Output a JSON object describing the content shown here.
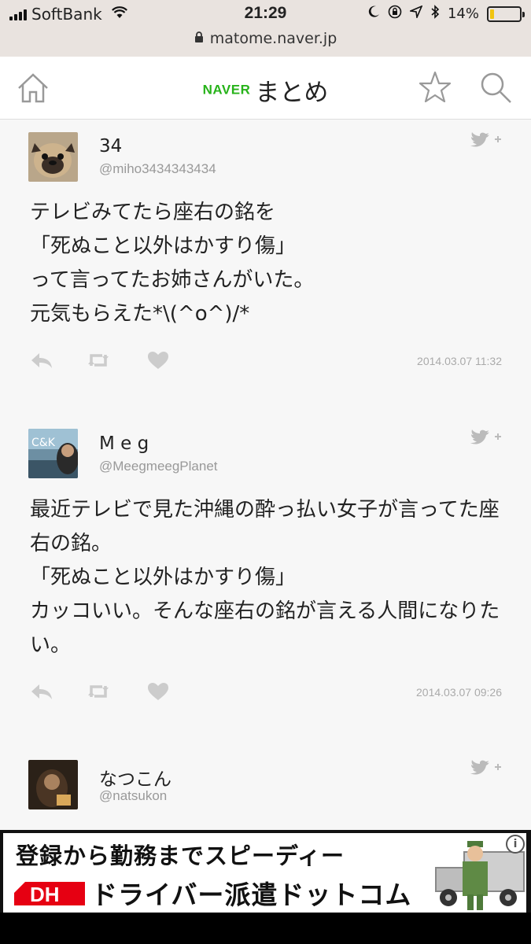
{
  "status_bar": {
    "carrier": "SoftBank",
    "time": "21:29",
    "battery": "14%",
    "battery_level": 0.14
  },
  "browser": {
    "url": "matome.naver.jp"
  },
  "header": {
    "brand_naver": "NAVER",
    "brand_matome": "まとめ"
  },
  "colors": {
    "naver_green": "#27b31a",
    "battery_yellow": "#f1c40f",
    "ad_red": "#e60012"
  },
  "tweets": [
    {
      "name": "34",
      "handle": "@miho3434343434",
      "body": "テレビみてたら座右の銘を\n「死ぬこと以外はかすり傷」\nって言ってたお姉さんがいた。\n元気もらえた*\\(^o^)/*",
      "date": "2014.03.07 11:32"
    },
    {
      "name": "M e g",
      "handle": "@MeegmeegPlanet",
      "body": "最近テレビで見た沖縄の酔っ払い女子が言ってた座右の銘。\n「死ぬこと以外はかすり傷」\nカッコいい。そんな座右の銘が言える人間になりたい。",
      "date": "2014.03.07 09:26"
    },
    {
      "name": "なつこん",
      "handle": "@natsukon"
    }
  ],
  "ad": {
    "line1": "登録から勤務までスピーディー",
    "logo_text": "DH",
    "line2": "ドライバー派遣ドットコム",
    "info_icon": "i"
  },
  "icons": {
    "home": "home-icon",
    "star": "star-icon",
    "search": "search-icon",
    "reply": "reply-icon",
    "retweet": "retweet-icon",
    "like": "heart-icon",
    "follow": "twitter-follow-icon"
  }
}
